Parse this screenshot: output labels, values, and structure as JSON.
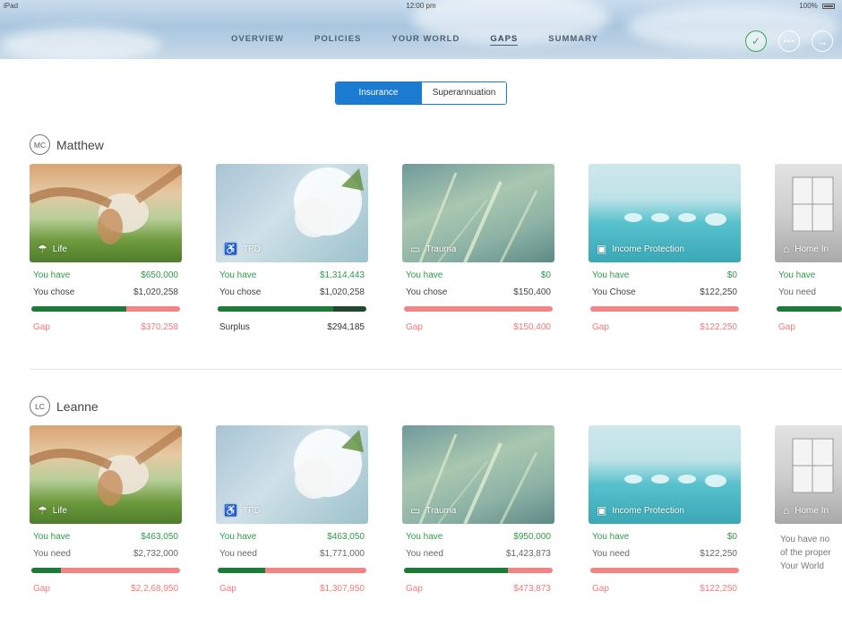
{
  "status_bar": {
    "left": "iPad",
    "time": "12:00 pm",
    "battery": "100%"
  },
  "nav": {
    "items": [
      "OVERVIEW",
      "POLICIES",
      "YOUR WORLD",
      "GAPS",
      "SUMMARY"
    ],
    "active": "GAPS"
  },
  "segment": {
    "insurance": "Insurance",
    "superannuation": "Superannuation",
    "selected": "Insurance"
  },
  "people": [
    {
      "initials": "MC",
      "name": "Matthew"
    },
    {
      "initials": "LC",
      "name": "Leanne"
    }
  ],
  "matthew_cards": [
    {
      "title": "Life",
      "icon": "umbrella-icon",
      "have_label": "You have",
      "have": "$650,000",
      "second_label": "You chose",
      "second": "$1,020,258",
      "coverage_fraction": 0.64,
      "result_label": "Gap",
      "result": "$370,258"
    },
    {
      "title": "TPD",
      "icon": "wheelchair-icon",
      "have_label": "You have",
      "have": "$1,314,443",
      "second_label": "You chose",
      "second": "$1,020,258",
      "coverage_fraction": 0.78,
      "result_label": "Surplus",
      "result": "$294,185"
    },
    {
      "title": "Trauma",
      "icon": "monitor-icon",
      "have_label": "You have",
      "have": "$0",
      "second_label": "You chose",
      "second": "$150,400",
      "coverage_fraction": 0,
      "result_label": "Gap",
      "result": "$150,400"
    },
    {
      "title": "Income Protection",
      "icon": "money-icon",
      "have_label": "You have",
      "have": "$0",
      "second_label": "You Chose",
      "second": "$122,250",
      "coverage_fraction": 0,
      "result_label": "Gap",
      "result": "$122,250"
    },
    {
      "title": "Home In",
      "icon": "home-icon",
      "have_label": "You have",
      "second_label": "You need",
      "coverage_fraction": 1,
      "result_label": "Gap"
    }
  ],
  "leanne_cards": [
    {
      "title": "Life",
      "icon": "umbrella-icon",
      "have_label": "You have",
      "have": "$463,050",
      "second_label": "You need",
      "second": "$2,732,000",
      "coverage_fraction": 0.2,
      "result_label": "Gap",
      "result": "$2,2,68,950"
    },
    {
      "title": "TPD",
      "icon": "wheelchair-icon",
      "have_label": "You have",
      "have": "$463,050",
      "second_label": "You need",
      "second": "$1,771,000",
      "coverage_fraction": 0.32,
      "result_label": "Gap",
      "result": "$1,307,950"
    },
    {
      "title": "Trauma",
      "icon": "monitor-icon",
      "have_label": "You have",
      "have": "$950,000",
      "second_label": "You need",
      "second": "$1,423,873",
      "coverage_fraction": 0.7,
      "result_label": "Gap",
      "result": "$473,873"
    },
    {
      "title": "Income Protection",
      "icon": "money-icon",
      "have_label": "You have",
      "have": "$0",
      "second_label": "You need",
      "second": "$122,250",
      "coverage_fraction": 0,
      "result_label": "Gap",
      "result": "$122,250"
    },
    {
      "title": "Home In",
      "icon": "home-icon",
      "note": "You have no of the proper Your World"
    }
  ],
  "colors": {
    "accent": "#1a7bd0",
    "have": "#2e9a47",
    "gap": "#ef7a7a",
    "bar_fill": "#1f7a3a"
  }
}
